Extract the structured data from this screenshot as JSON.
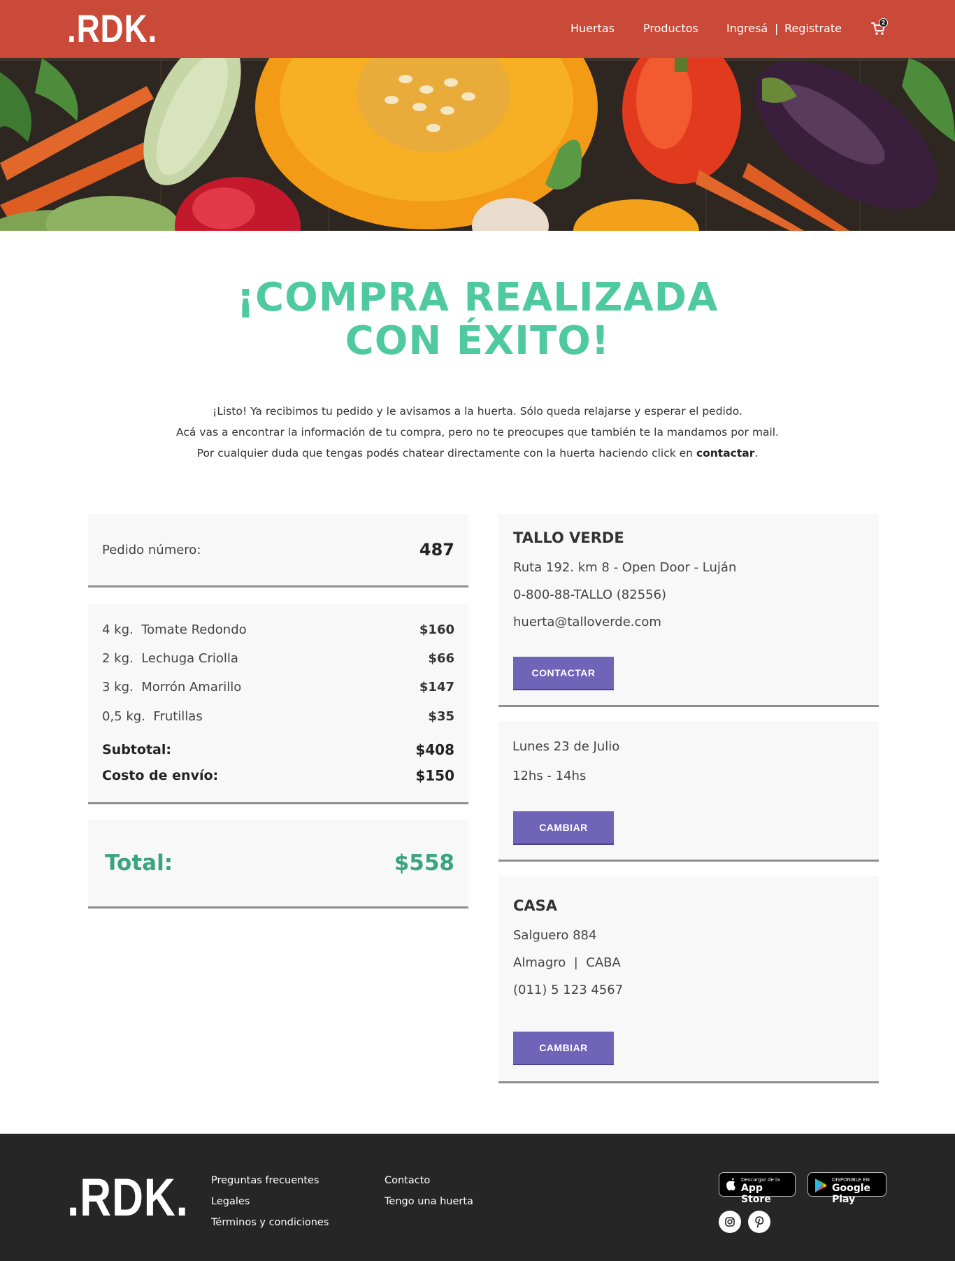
{
  "header": {
    "logo": ".RDK.",
    "nav": {
      "huertas": "Huertas",
      "productos": "Productos",
      "ingresa": "Ingresá",
      "separator": "|",
      "registrate": "Registrate"
    },
    "cart_count": "2",
    "colors": {
      "bar": "#c94a38"
    }
  },
  "hero": {
    "alt_icon": "vegetables-banner-image"
  },
  "title": {
    "line1": "¡COMPRA REALIZADA",
    "line2": "CON ÉXITO!",
    "color": "#4ec9a0"
  },
  "intro": {
    "line1": "¡Listo! Ya recibimos tu pedido y le avisamos a la huerta. Sólo queda relajarse y esperar el pedido.",
    "line2": "Acá vas a encontrar la información de tu compra, pero no te preocupes que también te la mandamos por mail.",
    "line3_prefix": "Por cualquier duda que tengas podés chatear directamente con la huerta haciendo click en ",
    "line3_bold": "contactar",
    "line3_suffix": "."
  },
  "order": {
    "number_label": "Pedido número:",
    "number": "487",
    "items": [
      {
        "qty": "4 kg.",
        "name": "Tomate Redondo",
        "price": "$160"
      },
      {
        "qty": "2 kg.",
        "name": "Lechuga Criolla",
        "price": "$66"
      },
      {
        "qty": "3 kg.",
        "name": "Morrón Amarillo",
        "price": "$147"
      },
      {
        "qty": "0,5 kg.",
        "name": "Frutillas",
        "price": "$35"
      }
    ],
    "subtotal_label": "Subtotal:",
    "subtotal": "$408",
    "shipping_label": "Costo de envío:",
    "shipping": "$150",
    "total_label": "Total:",
    "total": "$558"
  },
  "farm": {
    "name": "TALLO VERDE",
    "address": "Ruta 192. km 8 - Open Door - Luján",
    "phone": "0-800-88-TALLO (82556)",
    "email": "huerta@talloverde.com",
    "button": "CONTACTAR"
  },
  "delivery": {
    "date": "Lunes 23 de Julio",
    "time": "12hs - 14hs",
    "button": "CAMBIAR"
  },
  "address": {
    "name": "CASA",
    "street": "Salguero 884",
    "area": "Almagro  |  CABA",
    "phone": "(011) 5 123 4567",
    "button": "CAMBIAR"
  },
  "footer": {
    "logo": ".RDK.",
    "col1": [
      "Preguntas frecuentes",
      "Legales",
      "Términos y condiciones"
    ],
    "col2": [
      "Contacto",
      "Tengo una huerta"
    ],
    "appstore": {
      "small": "Descargar de la",
      "big": "App Store"
    },
    "googleplay": {
      "small": "DISPONIBLE EN",
      "big": "Google Play"
    },
    "social": [
      "instagram-icon",
      "pinterest-icon"
    ]
  }
}
